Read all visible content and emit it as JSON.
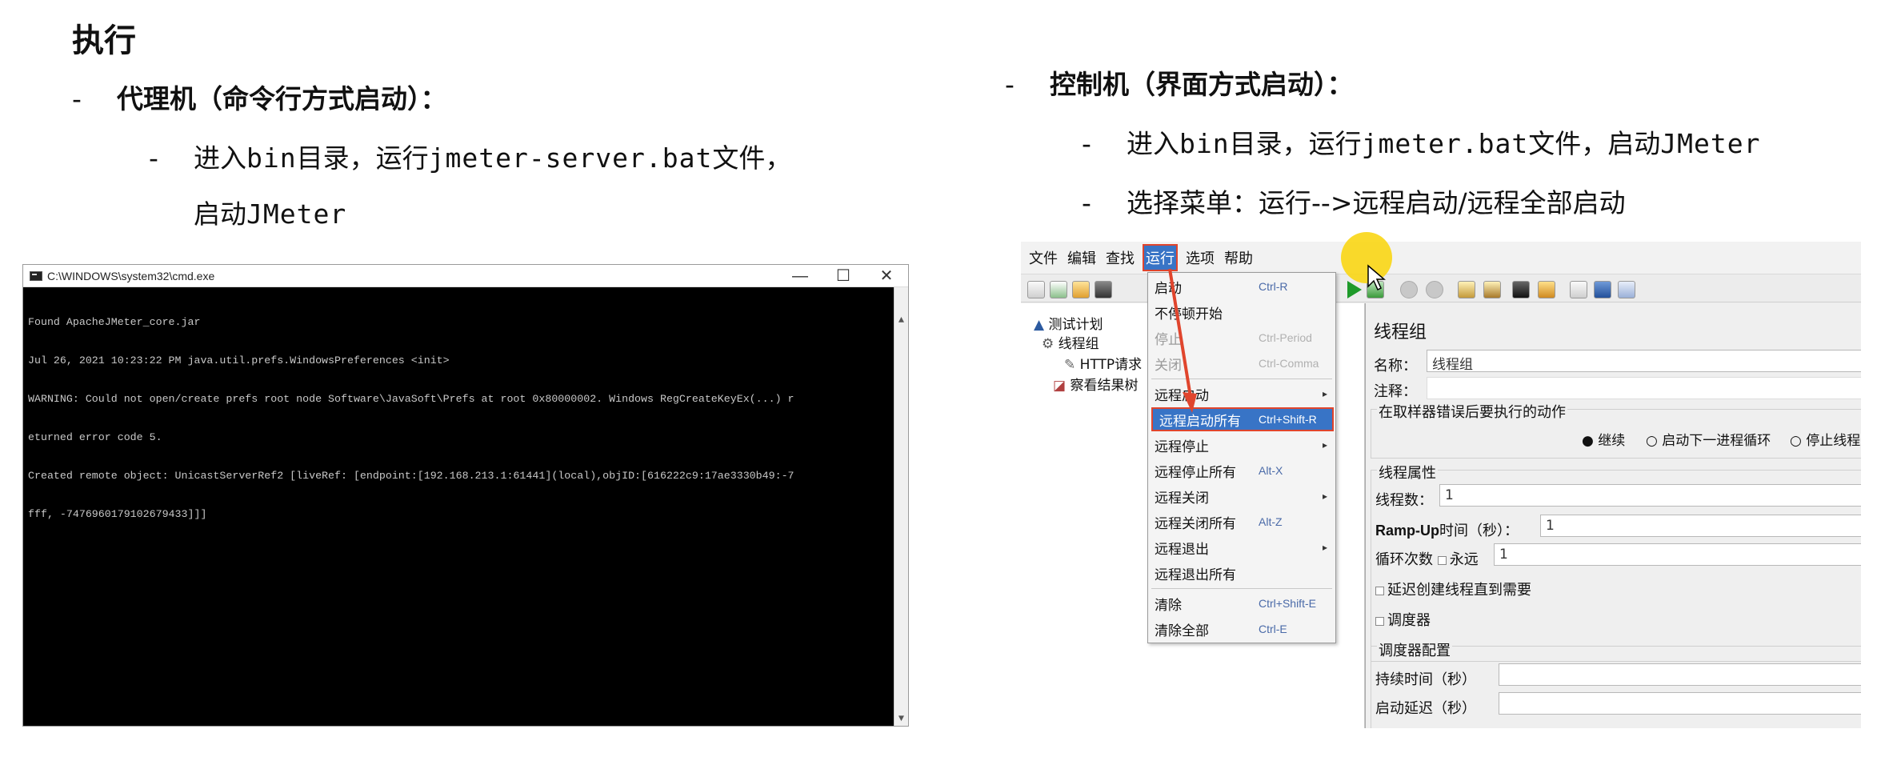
{
  "slide": {
    "title": "执行",
    "agent_heading": "代理机（命令行方式启动）：",
    "agent_step_line1_a": "进入",
    "agent_step_line1_code1": "bin",
    "agent_step_line1_b": "目录，运行",
    "agent_step_line1_code2": "jmeter-server.bat",
    "agent_step_line1_c": "文件，",
    "agent_step_line2_a": "启动",
    "agent_step_line2_code": "JMeter",
    "controller_heading": "控制机（界面方式启动）：",
    "ctrl_step1_a": "进入",
    "ctrl_step1_code1": "bin",
    "ctrl_step1_b": "目录，运行",
    "ctrl_step1_code2": "jmeter.bat",
    "ctrl_step1_c": "文件，启动",
    "ctrl_step1_code3": "JMeter",
    "ctrl_step2": "选择菜单：运行-->远程启动/远程全部启动",
    "dash": "-"
  },
  "cmd": {
    "title": "C:\\WINDOWS\\system32\\cmd.exe",
    "min": "—",
    "max": "☐",
    "close": "✕",
    "lines": [
      "Found ApacheJMeter_core.jar",
      "Jul 26, 2021 10:23:22 PM java.util.prefs.WindowsPreferences <init>",
      "WARNING: Could not open/create prefs root node Software\\JavaSoft\\Prefs at root 0x80000002. Windows RegCreateKeyEx(...) r",
      "eturned error code 5.",
      "Created remote object: UnicastServerRef2 [liveRef: [endpoint:[192.168.213.1:61441](local),objID:[616222c9:17ae3330b49:-7",
      "fff, -7476960179102679433]]]"
    ]
  },
  "jmeter": {
    "menubar": [
      "文件",
      "编辑",
      "查找",
      "运行",
      "选项",
      "帮助"
    ],
    "active_menu_index": 3,
    "tree": {
      "plan": "测试计划",
      "thread_group": "线程组",
      "http": "HTTP请求",
      "results": "察看结果树"
    },
    "run_menu": [
      {
        "label": "启动",
        "shortcut": "Ctrl-R"
      },
      {
        "label": "不停顿开始",
        "shortcut": ""
      },
      {
        "label": "停止",
        "shortcut": "Ctrl-Period",
        "disabled": true
      },
      {
        "label": "关闭",
        "shortcut": "Ctrl-Comma",
        "disabled": true
      },
      {
        "label": "远程启动",
        "shortcut": "",
        "submenu": true
      },
      {
        "label": "远程启动所有",
        "shortcut": "Ctrl+Shift-R",
        "highlight": true
      },
      {
        "label": "远程停止",
        "shortcut": "",
        "submenu": true
      },
      {
        "label": "远程停止所有",
        "shortcut": "Alt-X"
      },
      {
        "label": "远程关闭",
        "shortcut": "",
        "submenu": true
      },
      {
        "label": "远程关闭所有",
        "shortcut": "Alt-Z"
      },
      {
        "label": "远程退出",
        "shortcut": "",
        "submenu": true
      },
      {
        "label": "远程退出所有",
        "shortcut": ""
      },
      {
        "label": "清除",
        "shortcut": "Ctrl+Shift-E"
      },
      {
        "label": "清除全部",
        "shortcut": "Ctrl-E"
      }
    ],
    "panel": {
      "title": "线程组",
      "name_label": "名称：",
      "name_value": "线程组",
      "comment_label": "注释：",
      "sampler_error_legend": "在取样器错误后要执行的动作",
      "opt_continue": "继续",
      "opt_next_loop": "启动下一进程循环",
      "opt_stop_thread": "停止线程",
      "thread_props_legend": "线程属性",
      "threads_label": "线程数：",
      "threads_value": "1",
      "rampup_label_en": "Ramp-Up",
      "rampup_label_cn": "时间（秒）：",
      "rampup_value": "1",
      "loop_label": "循环次数",
      "forever_label": "永远",
      "loop_value": "1",
      "delay_create": "延迟创建线程直到需要",
      "scheduler": "调度器",
      "scheduler_config_legend": "调度器配置",
      "duration_label": "持续时间（秒）",
      "startup_delay_label": "启动延迟（秒）"
    }
  },
  "colors": {
    "highlight_blue": "#3874c6",
    "annotation_red": "#e0452d",
    "cursor_yellow": "#fad614"
  }
}
